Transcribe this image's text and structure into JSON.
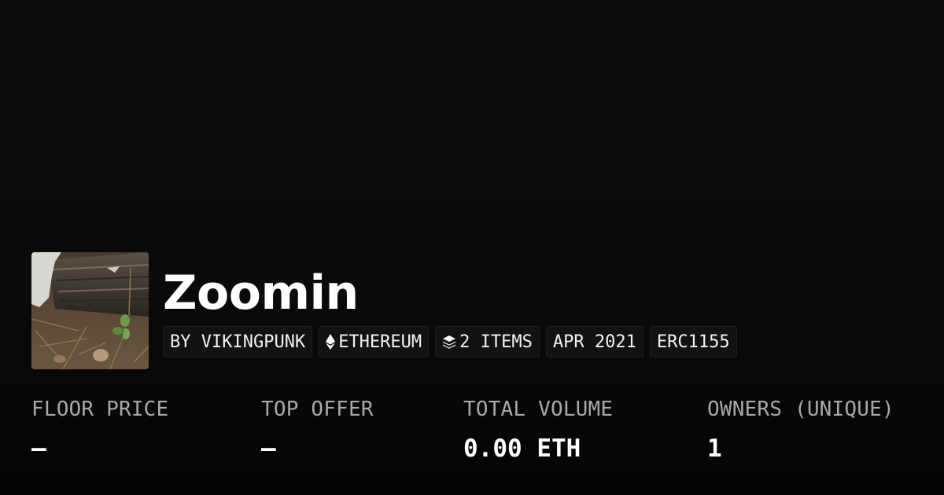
{
  "collection": {
    "title": "Zoomin",
    "thumbnail_icon": "collection-photo-thumbnail",
    "tags": {
      "creator": "BY VIKINGPUNK",
      "chain": "ETHEREUM",
      "chain_icon": "ethereum-icon",
      "items": "2 ITEMS",
      "items_icon": "layers-icon",
      "date": "APR 2021",
      "standard": "ERC1155"
    }
  },
  "stats": {
    "floor_price": {
      "label": "FLOOR PRICE",
      "value": "—"
    },
    "top_offer": {
      "label": "TOP OFFER",
      "value": "—"
    },
    "total_volume": {
      "label": "TOTAL VOLUME",
      "value": "0.00 ETH"
    },
    "owners": {
      "label": "OWNERS (UNIQUE)",
      "value": "1"
    }
  }
}
